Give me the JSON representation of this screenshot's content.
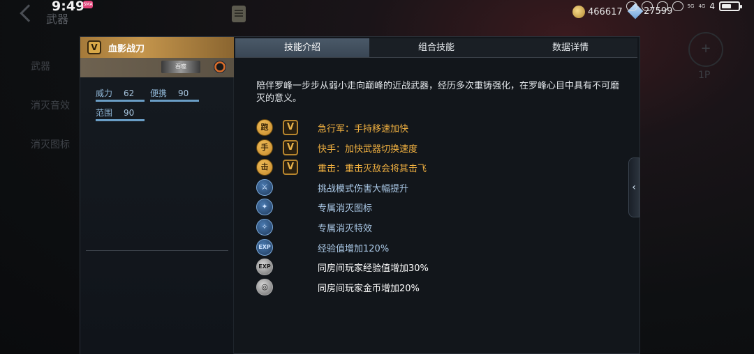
{
  "status_bar": {
    "time": "9:49",
    "notif_badge": "SMA",
    "network_top": "5G",
    "network_bottom": "4G",
    "signal_count": "4",
    "battery_level": 0.6
  },
  "header": {
    "back_label": "",
    "page_title": "武器",
    "coins": "466617",
    "gems": "27599"
  },
  "left_nav": {
    "items": [
      "武器",
      "消灭音效",
      "消灭图标"
    ]
  },
  "right_side": {
    "player_label": "1P"
  },
  "weapon_card": {
    "name": "血影战刀",
    "tier_badge": "V",
    "tag": "吞噬",
    "stats": [
      {
        "label": "威力",
        "value": "62"
      },
      {
        "label": "便携",
        "value": "90"
      },
      {
        "label": "范围",
        "value": "90"
      }
    ]
  },
  "tabs": [
    {
      "label": "技能介绍",
      "active": true
    },
    {
      "label": "组合技能",
      "active": false
    },
    {
      "label": "数据详情",
      "active": false
    }
  ],
  "description": "陪伴罗峰一步步从弱小走向巅峰的近战武器，经历多次重铸强化，在罗峰心目中具有不可磨灭的意义。",
  "skills": [
    {
      "icon": "running-man-icon",
      "style": "gold",
      "has_v": true,
      "text": "急行军：手持移速加快",
      "text_color": "gold"
    },
    {
      "icon": "hand-swap-icon",
      "style": "gold",
      "has_v": true,
      "text": "快手：加快武器切换速度",
      "text_color": "gold"
    },
    {
      "icon": "heavy-strike-icon",
      "style": "gold",
      "has_v": true,
      "text": "重击：重击灭敌会将其击飞",
      "text_color": "gold"
    },
    {
      "icon": "challenge-damage-icon",
      "style": "blue",
      "has_v": false,
      "text": "挑战模式伤害大幅提升",
      "text_color": "blue"
    },
    {
      "icon": "kill-icon-icon",
      "style": "blue",
      "has_v": false,
      "text": "专属消灭图标",
      "text_color": "blue"
    },
    {
      "icon": "kill-effect-icon",
      "style": "blue",
      "has_v": false,
      "text": "专属消灭特效",
      "text_color": "blue"
    },
    {
      "icon": "exp-icon",
      "style": "blue",
      "has_v": false,
      "text": "经验值增加120%",
      "text_color": "blue"
    },
    {
      "icon": "room-exp-icon",
      "style": "silver",
      "has_v": false,
      "text": "同房间玩家经验值增加30%",
      "text_color": "white"
    },
    {
      "icon": "room-gold-icon",
      "style": "silver",
      "has_v": false,
      "text": "同房间玩家金币增加20%",
      "text_color": "white"
    }
  ]
}
